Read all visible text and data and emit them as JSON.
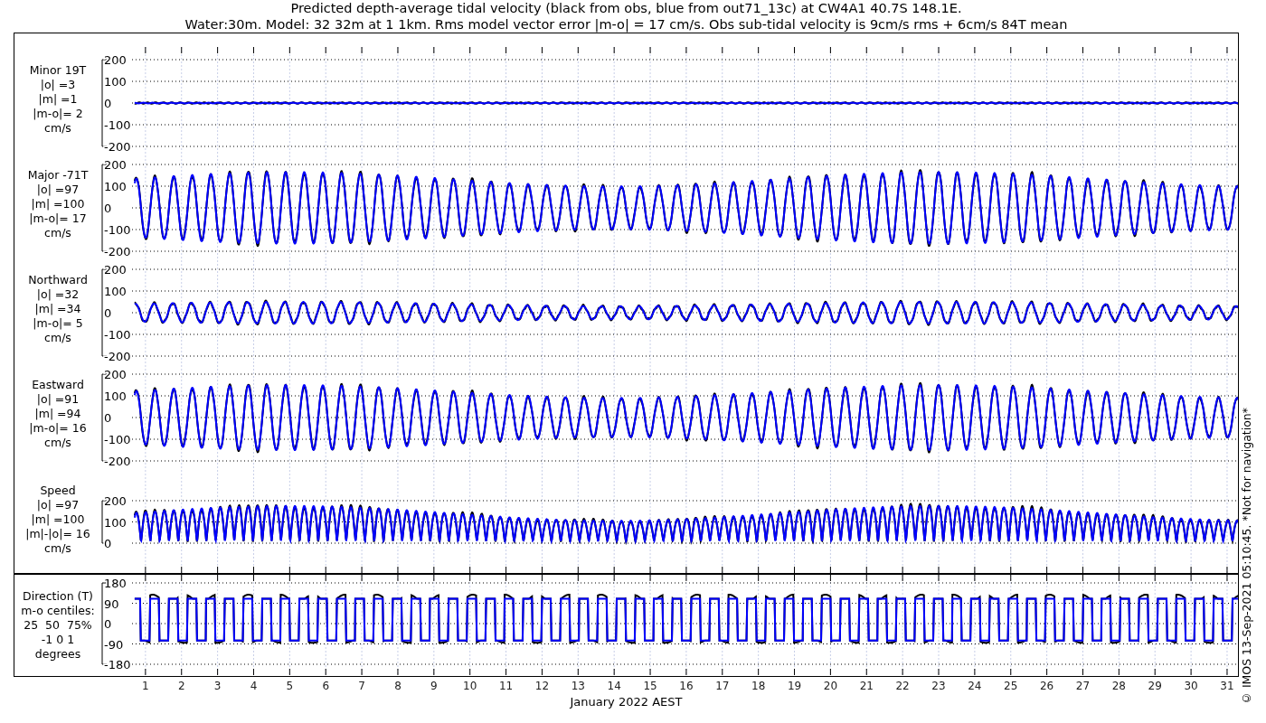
{
  "title_lines": [
    "Predicted depth-average tidal velocity (black from obs, blue from out71_13c) at CW4A1 40.7S 148.1E.",
    "Water:30m. Model: 32 32m at 1 1km. Rms model vector error |m-o| = 17 cm/s. Obs sub-tidal velocity is 9cm/s rms + 6cm/s 84T mean"
  ],
  "panels": [
    {
      "kind": "signed",
      "label_lines": [
        "Minor 19T",
        "|o| =3",
        "|m| =1",
        "|m-o|= 2",
        "cm/s"
      ],
      "yticks": [
        "200",
        "100",
        "0",
        "-100",
        "-200"
      ]
    },
    {
      "kind": "signed",
      "label_lines": [
        "Major -71T",
        "|o| =97",
        "|m| =100",
        "|m-o|= 17",
        "cm/s"
      ],
      "yticks": [
        "200",
        "100",
        "0",
        "-100",
        "-200"
      ]
    },
    {
      "kind": "signed",
      "label_lines": [
        "Northward",
        "|o| =32",
        "|m| =34",
        "|m-o|= 5",
        "cm/s"
      ],
      "yticks": [
        "200",
        "100",
        "0",
        "-100",
        "-200"
      ]
    },
    {
      "kind": "signed",
      "label_lines": [
        "Eastward",
        "|o| =91",
        "|m| =94",
        "|m-o|= 16",
        "cm/s"
      ],
      "yticks": [
        "200",
        "100",
        "0",
        "-100",
        "-200"
      ]
    },
    {
      "kind": "speed",
      "label_lines": [
        "Speed",
        "|o| =97",
        "|m| =100",
        "|m|-|o|= 16",
        "cm/s"
      ],
      "yticks": [
        "200",
        "100",
        "0"
      ]
    },
    {
      "kind": "direction",
      "label_lines": [
        "Direction (T)",
        "m-o centiles:",
        "25  50  75%",
        "-1 0 1",
        "degrees"
      ],
      "yticks": [
        "180",
        "90",
        "0",
        "-90",
        "-180"
      ]
    }
  ],
  "x_ticks": [
    "1",
    "2",
    "3",
    "4",
    "5",
    "6",
    "7",
    "8",
    "9",
    "10",
    "11",
    "12",
    "13",
    "14",
    "15",
    "16",
    "17",
    "18",
    "19",
    "20",
    "21",
    "22",
    "23",
    "24",
    "25",
    "26",
    "27",
    "28",
    "29",
    "30",
    "31"
  ],
  "x_axis_label": "January 2022 AEST",
  "footer_note": "© IMOS 13-Sep-2021 05:10:45. *Not for navigation*"
}
